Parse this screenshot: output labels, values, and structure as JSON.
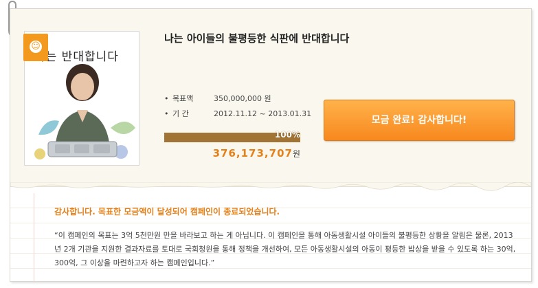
{
  "campaign": {
    "title": "나는 아이들의 불평등한 식판에 반대합니다",
    "photo_caption": "나는 반대합니다",
    "goal_label": "목표액",
    "goal_value": "350,000,000 원",
    "period_label": "기 간",
    "period_value": "2012.11.12 ~ 2013.01.31",
    "progress_percent": 100,
    "progress_text": "100%",
    "raised_amount": "376,173,707",
    "raised_unit": "원",
    "cta_label": "모금 완료! 감사합니다!"
  },
  "notice": {
    "headline": "감사합니다. 목표한 모금액이 달성되어 캠페인이 종료되었습니다.",
    "body": "“이 캠페인의 목표는 3억 5천만원 만을 바라보고 하는 게 아닙니다. 이 캠페인을 통해 아동생활시설 아이들의 불평등한 상황을 알림은 물론, 2013년 2개 기관을 지원한 결과자료를 토대로 국회청원을 통해 정책을 개선하여, 모든 아동생활시설의 아동이 평등한 밥상을 받을 수 있도록 하는 30억, 300억, 그 이상을 마련하고자 하는 캠페인입니다.”"
  },
  "colors": {
    "accent": "#f7881e",
    "progress": "#a17334",
    "headline": "#e4811b"
  },
  "icons": {
    "badge": "smiley-icon",
    "clip": "paperclip-icon"
  }
}
